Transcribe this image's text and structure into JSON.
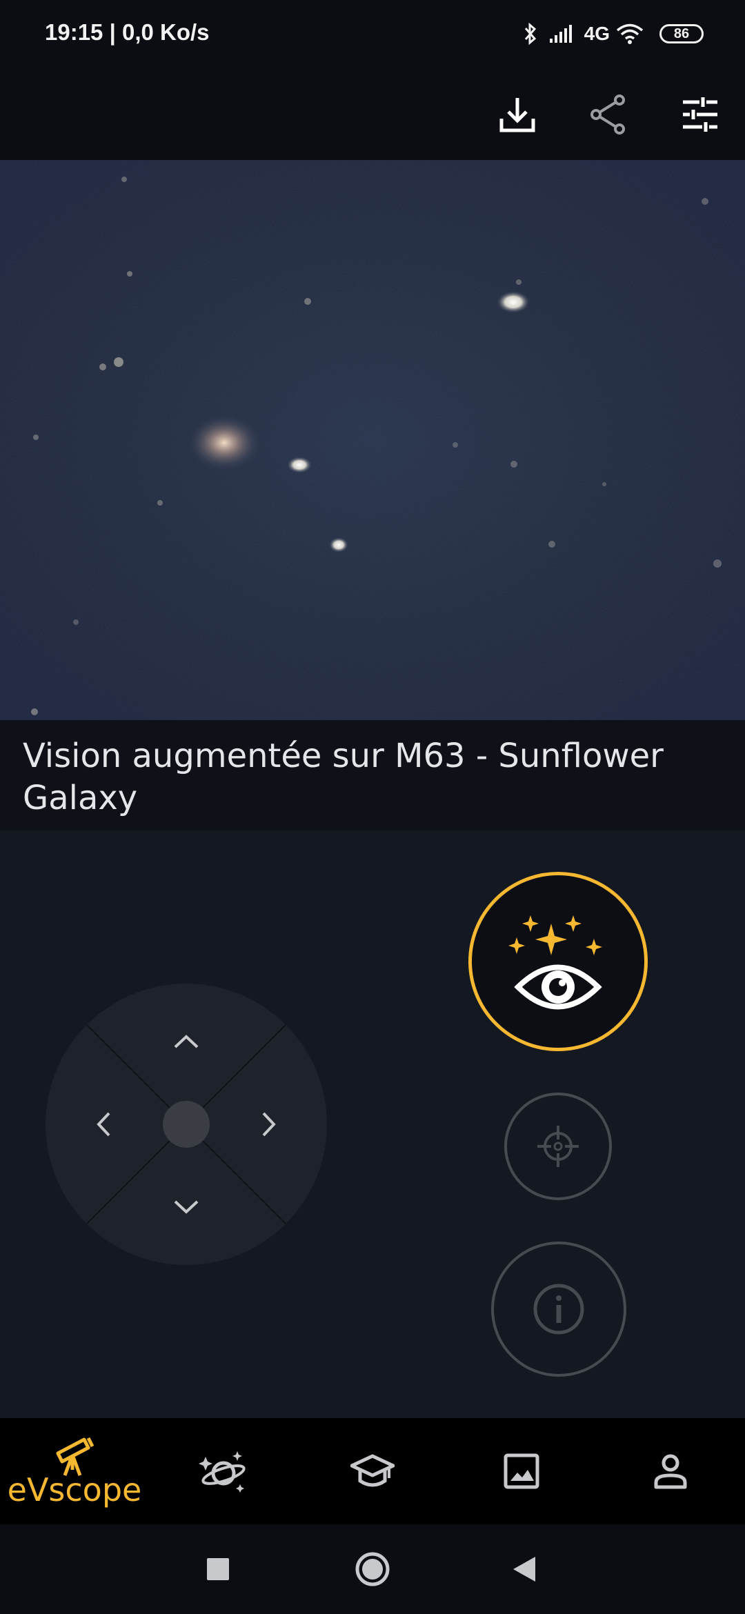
{
  "status_bar": {
    "time_speed": "19:15 | 0,0 Ko/s",
    "network": "4G",
    "battery": "86"
  },
  "app_bar": {
    "icons": [
      "download-icon",
      "share-icon",
      "tune-icon"
    ]
  },
  "caption": {
    "title": "Vision augmentée sur M63 - Sunflower Galaxy"
  },
  "controls": {
    "joystick_icons": [
      "chevron-up-icon",
      "chevron-left-icon",
      "chevron-right-icon",
      "chevron-down-icon"
    ],
    "enhanced_vision_icon": "sparkle-eye-icon",
    "target_icon": "crosshair-icon",
    "info_icon": "info-icon",
    "accent_color": "#f6b731"
  },
  "bottom_nav": {
    "items": [
      {
        "icon": "telescope-icon",
        "label": "eVscope",
        "active": true
      },
      {
        "icon": "planet-icon"
      },
      {
        "icon": "graduation-cap-icon"
      },
      {
        "icon": "image-icon"
      },
      {
        "icon": "person-icon"
      }
    ]
  },
  "system_nav": [
    "square-icon",
    "circle-icon",
    "back-triangle-icon"
  ]
}
